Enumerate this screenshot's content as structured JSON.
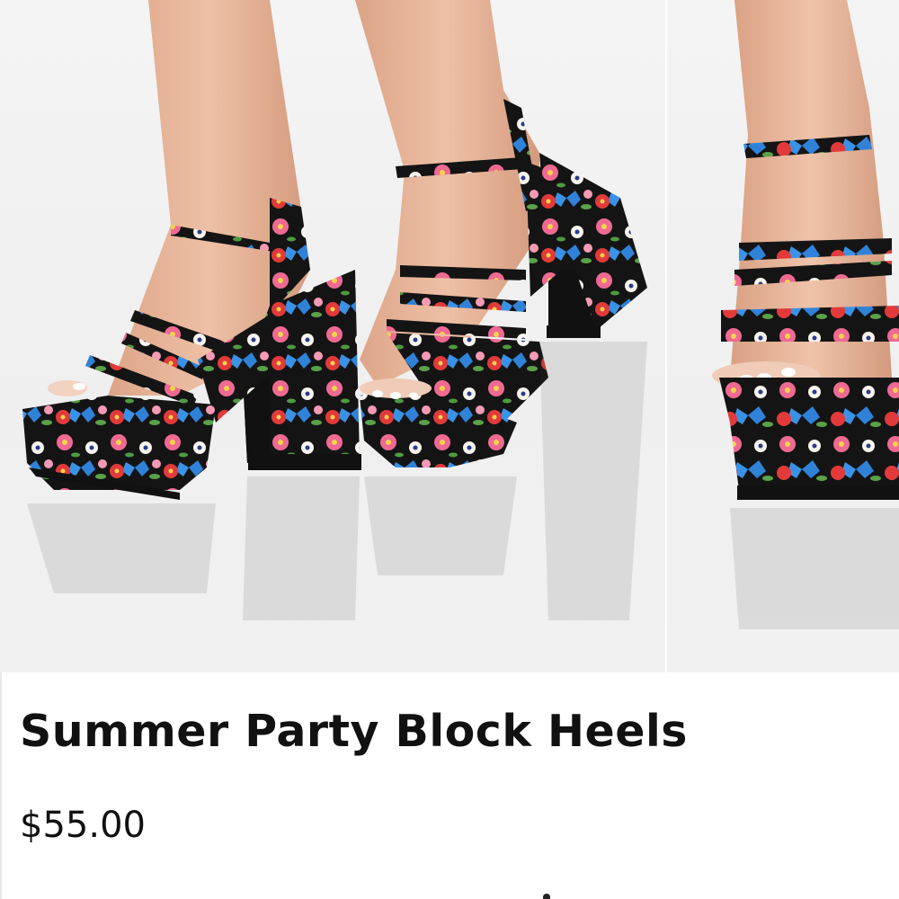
{
  "product": {
    "title": "Summer Party Block Heels",
    "price": "$55.00"
  },
  "gallery": {
    "images": [
      {
        "name": "product-image-main"
      },
      {
        "name": "product-image-next"
      }
    ]
  },
  "colors": {
    "sole": "#111111",
    "skin": "#e9b79a",
    "pink": "#ef5f8a",
    "red": "#e23a3a",
    "blue": "#2f82d8",
    "green": "#5aa24a",
    "white": "#f7f4ee",
    "background": "#f1f1f1"
  }
}
